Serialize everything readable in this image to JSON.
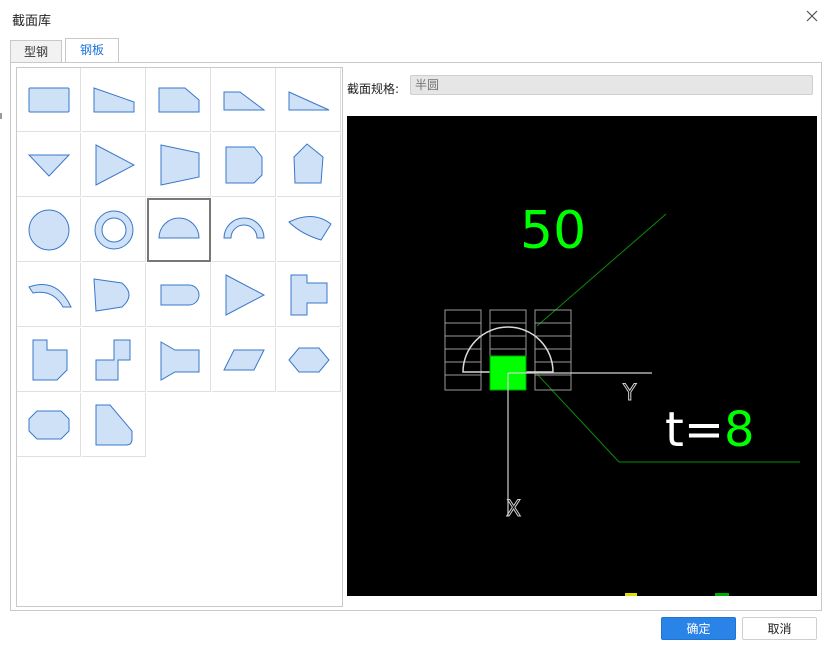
{
  "window": {
    "title": "截面库"
  },
  "tabs": [
    {
      "label": "型钢"
    },
    {
      "label": "钢板",
      "active": true
    }
  ],
  "spec": {
    "label": "截面规格:",
    "placeholder": "半圆"
  },
  "shapes": [
    "rectangle",
    "right-trapezoid",
    "chamfered-plate",
    "low-triangle",
    "flat-triangle",
    "down-triangle",
    "right-pointing-triangle",
    "tapered-trapezoid",
    "chamfered-pentagon",
    "irregular-pentagon",
    "circle",
    "ring",
    "semicircle",
    "semi-ring",
    "circular-segment",
    "curved-strip",
    "bullet-plate",
    "stadium",
    "triangle",
    "t-shape",
    "l-corner",
    "z-shape",
    "taper-block",
    "parallelogram",
    "hexagon",
    "octagon",
    "rounded-corner-plate"
  ],
  "selected_shape": "semicircle",
  "preview": {
    "dimension": "50",
    "thickness_label": "t=",
    "thickness_value": "8",
    "axis_y": "Y",
    "axis_x": "X"
  },
  "colors": {
    "accent": "#2a83e6",
    "shape_fill": "#cfe1f7",
    "shape_stroke": "#3a78c8",
    "preview_green": "#00ff00",
    "preview_bg": "#000000"
  },
  "buttons": {
    "ok": "确定",
    "cancel": "取消"
  }
}
